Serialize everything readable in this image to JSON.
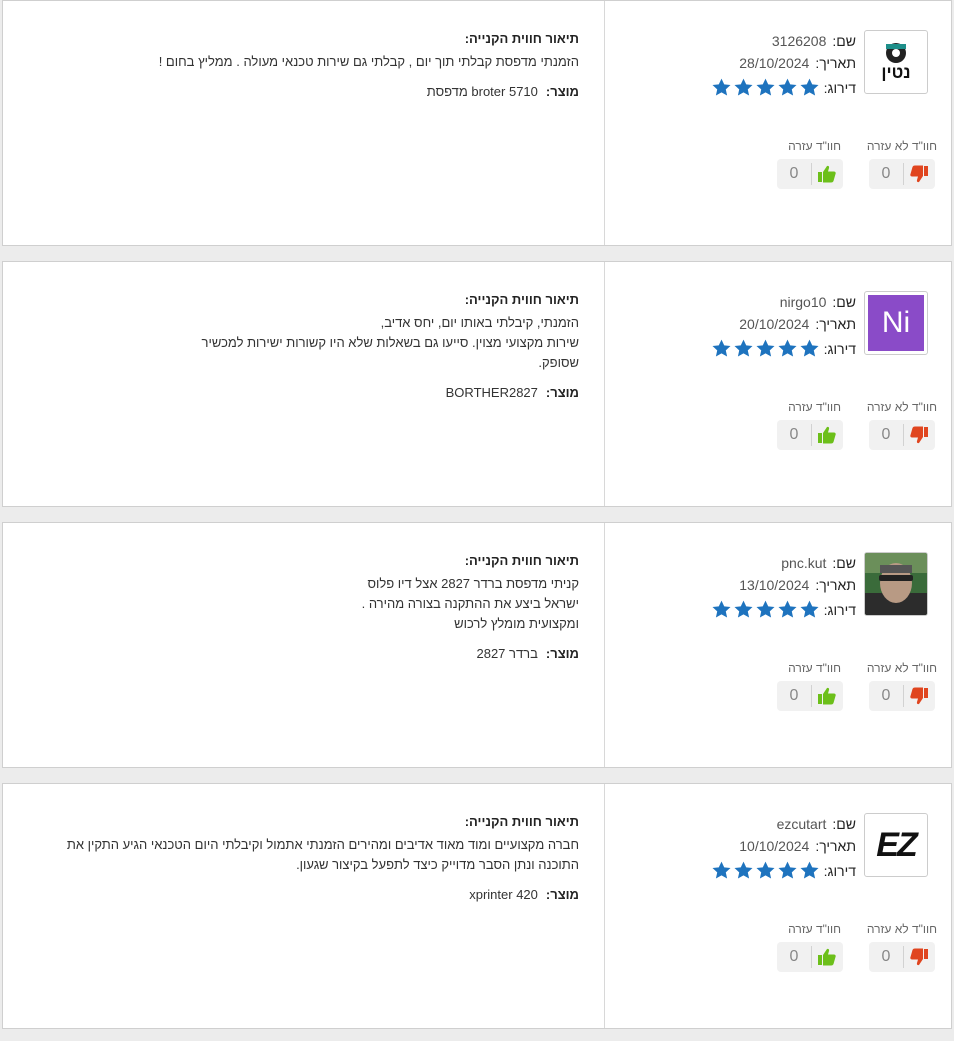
{
  "labels": {
    "name": "שם:",
    "date": "תאריך:",
    "rating": "דירוג:",
    "not_helpful": "חוו\"ד לא עזרה",
    "helpful": "חוו\"ד עזרה",
    "description": "תיאור חווית הקנייה:",
    "product": "מוצר:"
  },
  "colors": {
    "star": "#1e73be",
    "thumb_up": "#6cbf1a",
    "thumb_down": "#e0451f"
  },
  "reviews": [
    {
      "name": "3126208",
      "date": "28/10/2024",
      "rating": 5,
      "avatar": "logo-neteen",
      "avatar_text": "נטין",
      "not_helpful_count": "0",
      "helpful_count": "0",
      "description_lines": [
        "הזמנתי מדפסת קבלתי תוך יום , קבלתי גם שירות טכנאי מעולה . ממליץ בחום !"
      ],
      "product": "broter 5710  מדפסת"
    },
    {
      "name": "nirgo10",
      "date": "20/10/2024",
      "rating": 5,
      "avatar": "initials",
      "avatar_text": "Ni",
      "not_helpful_count": "0",
      "helpful_count": "0",
      "description_lines": [
        "הזמנתי, קיבלתי באותו יום, יחס אדיב,",
        "שירות מקצועי מצוין. סייעו גם בשאלות שלא היו קשורות ישירות למכשיר",
        "שסופק."
      ],
      "product": "BORTHER2827"
    },
    {
      "name": "pnc.kut",
      "date": "13/10/2024",
      "rating": 5,
      "avatar": "photo",
      "avatar_text": "",
      "not_helpful_count": "0",
      "helpful_count": "0",
      "description_lines": [
        "קניתי מדפסת ברדר 2827 אצל דיו פלוס",
        "ישראל ביצע את ההתקנה בצורה מהירה .",
        "ומקצועית מומלץ לרכוש"
      ],
      "product": "ברדר 2827"
    },
    {
      "name": "ezcutart",
      "date": "10/10/2024",
      "rating": 5,
      "avatar": "logo-ez",
      "avatar_text": "EZ",
      "not_helpful_count": "0",
      "helpful_count": "0",
      "description_lines": [
        "חברה מקצועיים ומוד מאוד אדיבים ומהירים הזמנתי אתמול וקיבלתי היום הטכנאי הגיע התקין את",
        "התוכנה ונתן הסבר מדוייק כיצד לתפעל בקיצור שגעון."
      ],
      "product": "xprinter 420"
    }
  ]
}
